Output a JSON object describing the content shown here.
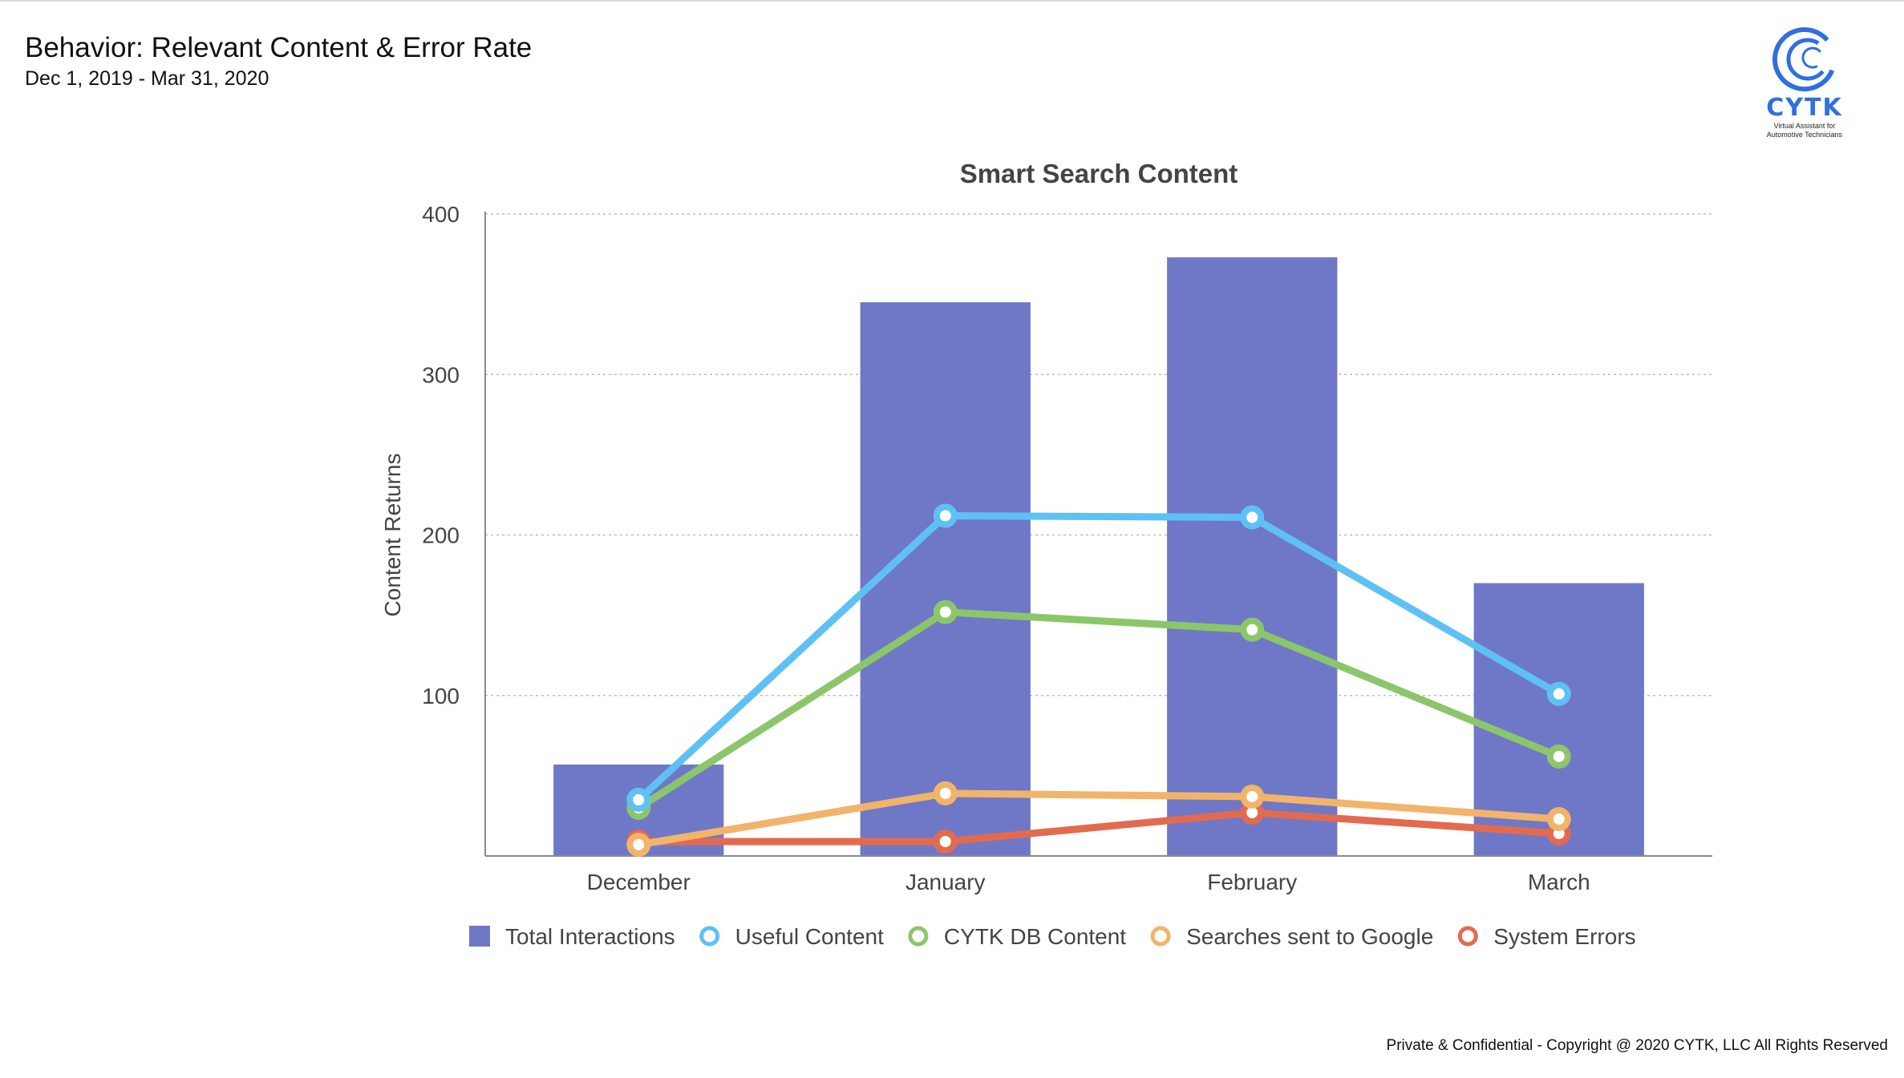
{
  "header": {
    "title": "Behavior: Relevant Content & Error Rate",
    "date_range": "Dec 1, 2019 - Mar 31, 2020"
  },
  "logo": {
    "name": "CYTK",
    "tagline_line1": "Virtual Assistant for",
    "tagline_line2": "Automotive Technicians",
    "color": "#2f6fe0"
  },
  "footer": {
    "text": "Private & Confidential - Copyright @ 2020 CYTK, LLC All Rights Reserved"
  },
  "chart_data": {
    "type": "bar",
    "title": "Smart Search Content",
    "xlabel": "",
    "ylabel": "Content Returns",
    "ylim": [
      0,
      400
    ],
    "yticks": [
      100,
      200,
      300,
      400
    ],
    "grid": true,
    "legend_position": "bottom",
    "categories": [
      "December",
      "January",
      "February",
      "March"
    ],
    "series": [
      {
        "name": "Total Interactions",
        "kind": "bar",
        "color": "#6f78c6",
        "values": [
          57,
          345,
          373,
          170
        ]
      },
      {
        "name": "Useful Content",
        "kind": "line",
        "color": "#5ec1f5",
        "values": [
          35,
          212,
          211,
          101
        ]
      },
      {
        "name": "CYTK DB Content",
        "kind": "line",
        "color": "#8cc66b",
        "values": [
          30,
          152,
          141,
          62
        ]
      },
      {
        "name": "Searches sent to Google",
        "kind": "line",
        "color": "#f2b46a",
        "values": [
          7,
          39,
          37,
          23
        ]
      },
      {
        "name": "System Errors",
        "kind": "line",
        "color": "#e26b4f",
        "values": [
          9,
          9,
          27,
          14
        ]
      }
    ]
  }
}
